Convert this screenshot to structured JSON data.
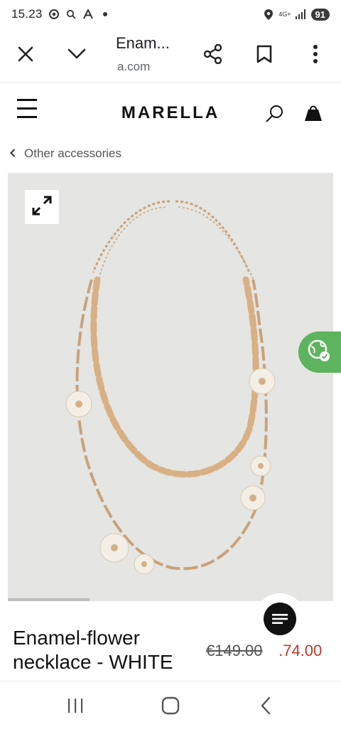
{
  "status_bar": {
    "time": "15.23",
    "network": "4G+",
    "battery": "91"
  },
  "browser": {
    "title": "Enam...",
    "url": "a.com"
  },
  "site": {
    "logo": "MARELLA"
  },
  "breadcrumb": {
    "label": "Other accessories"
  },
  "product": {
    "title": "Enamel-flower necklace - WHITE",
    "price_old": "€149.00",
    "price_new": " .74.00"
  },
  "colors": {
    "sale_price": "#c0392b",
    "translate_fab": "#5db35e",
    "image_bg": "#e5e5e3"
  },
  "icons": {
    "close": "close-icon",
    "chevron": "chevron-down-icon",
    "share": "share-icon",
    "bookmark": "bookmark-icon",
    "more": "more-vert-icon",
    "menu": "menu-icon",
    "search": "search-icon",
    "bag": "shopping-bag-icon",
    "expand": "expand-icon",
    "translate": "translate-icon",
    "chat": "chat-icon"
  }
}
